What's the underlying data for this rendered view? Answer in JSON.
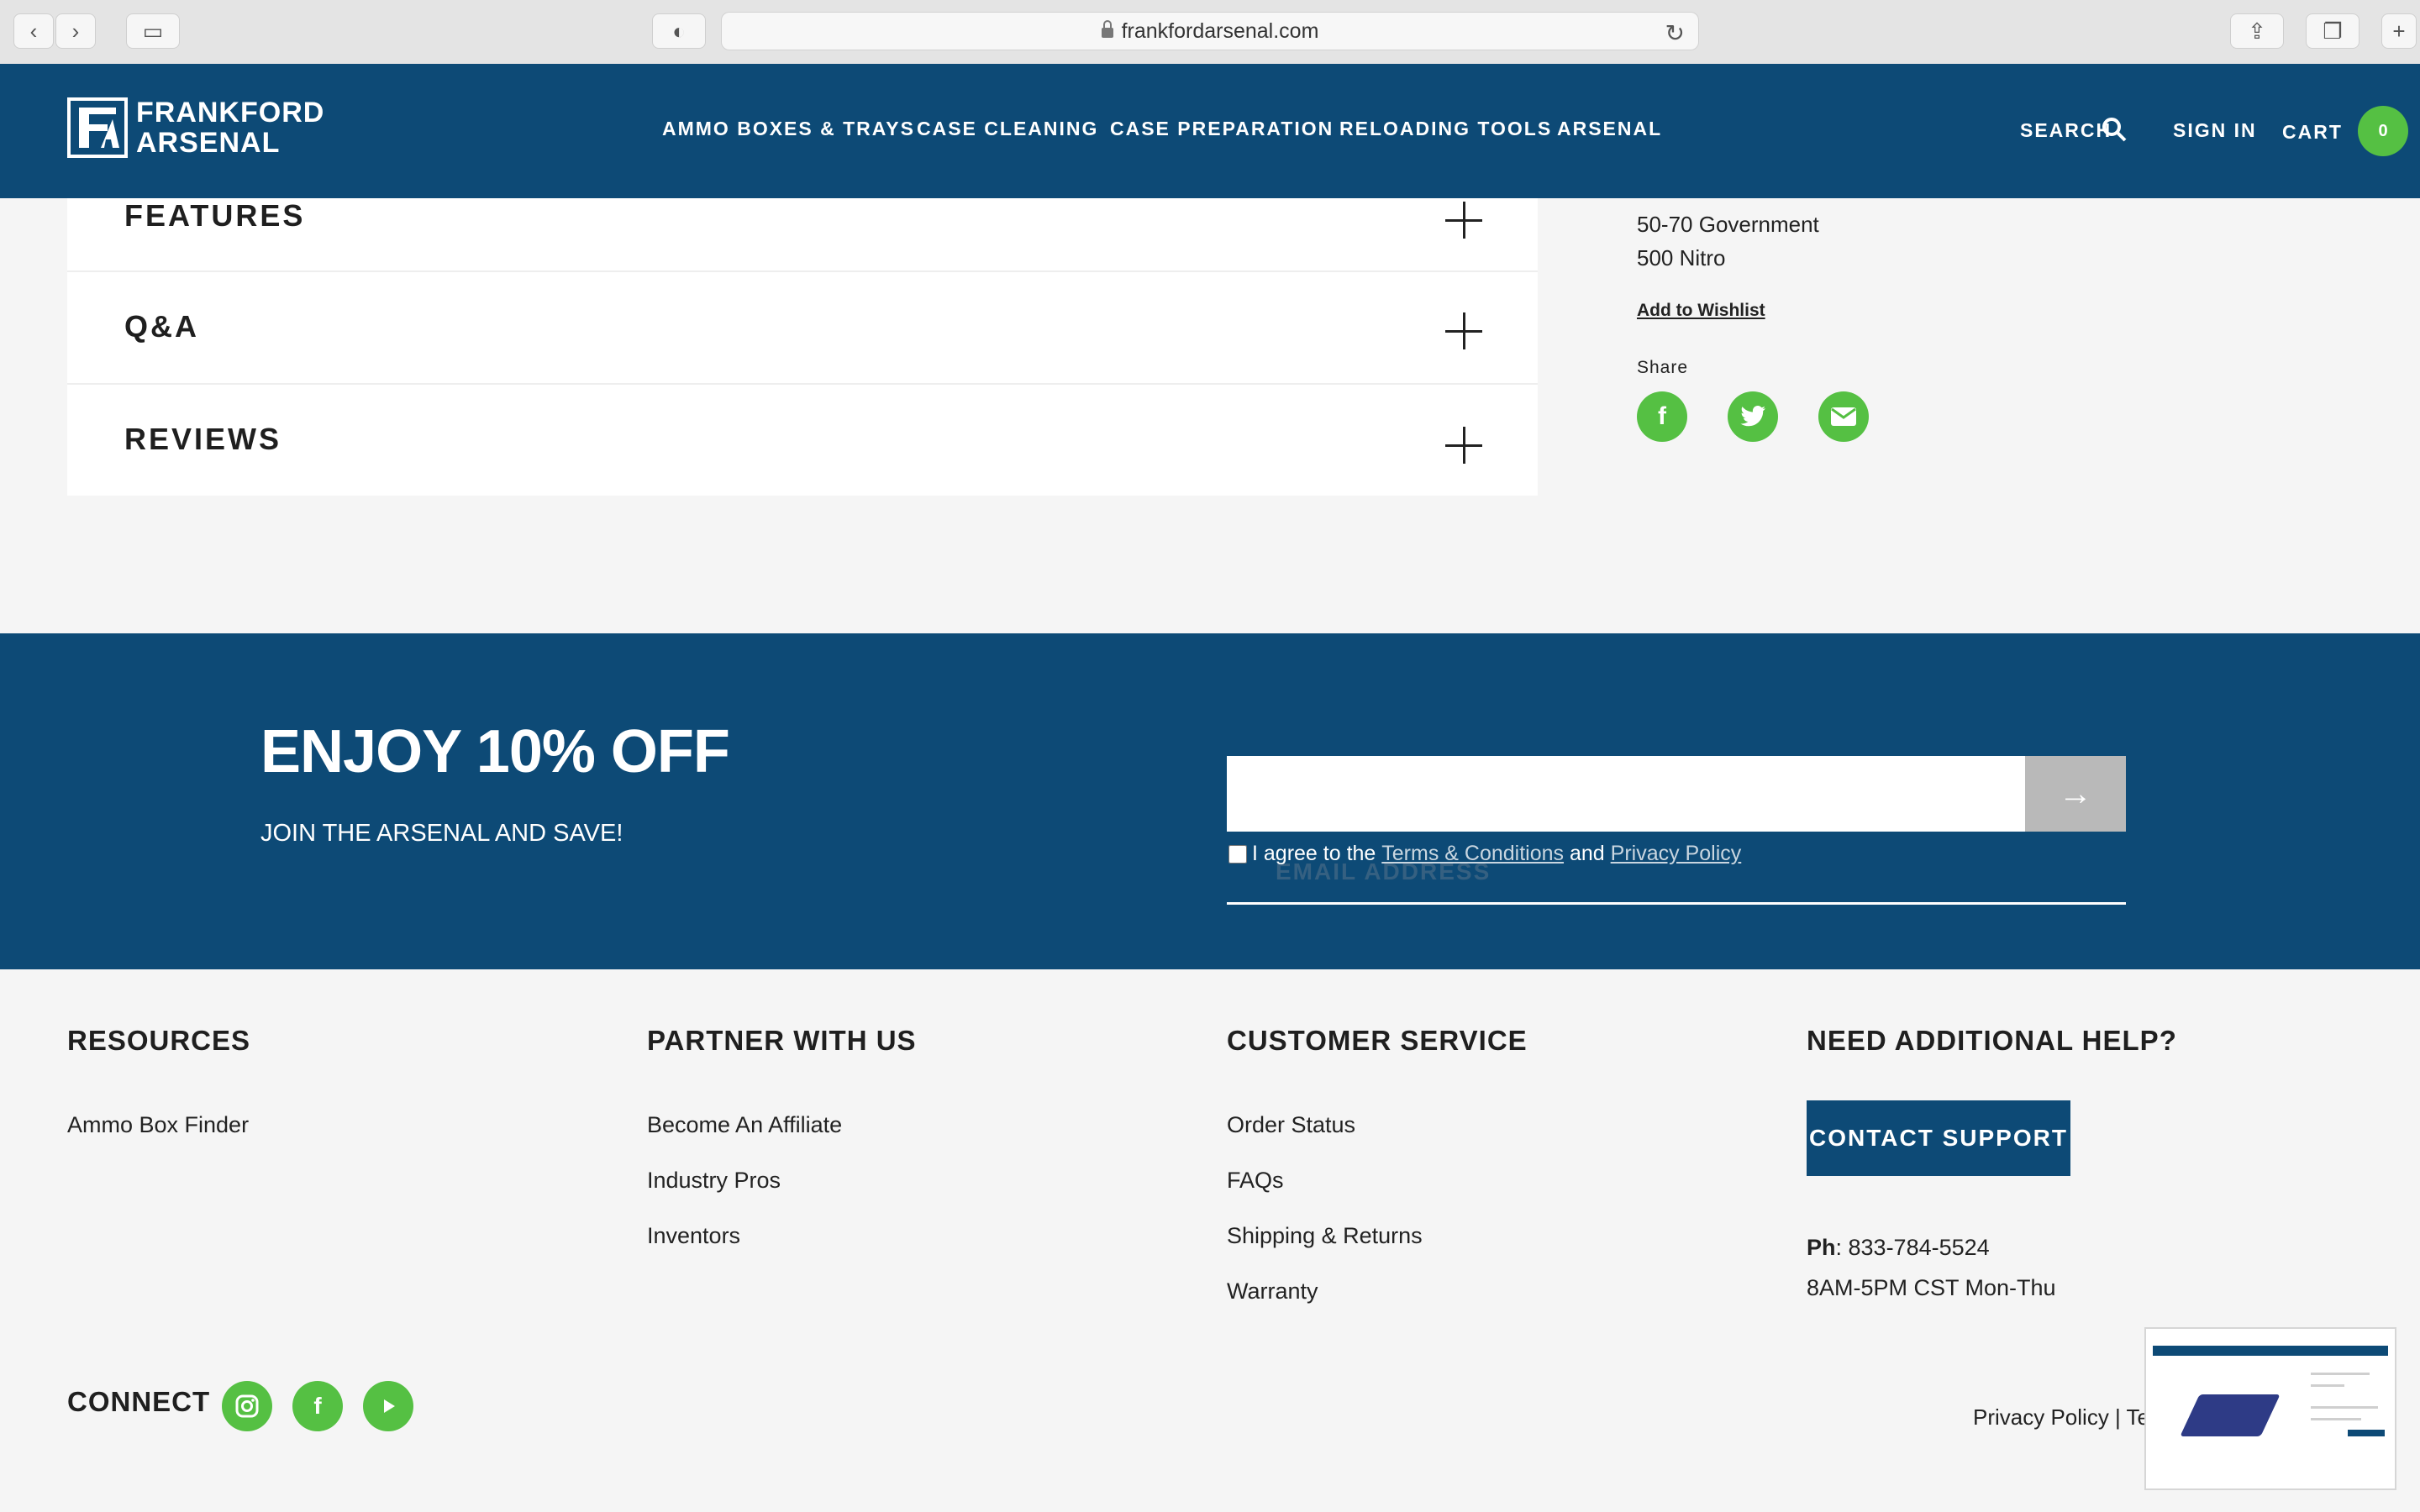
{
  "browser": {
    "url": "frankfordarsenal.com"
  },
  "header": {
    "logo_line1": "FRANKFORD",
    "logo_line2": "ARSENAL",
    "nav": [
      "AMMO BOXES & TRAYS",
      "CASE CLEANING",
      "CASE PREPARATION",
      "RELOADING TOOLS",
      "ARSENAL"
    ],
    "search_label": "SEARCH",
    "signin_label": "SIGN IN",
    "cart_label": "CART",
    "cart_count": "0"
  },
  "accordion": {
    "items": [
      "FEATURES",
      "Q&A",
      "REVIEWS"
    ]
  },
  "product_side": {
    "calibers": [
      "50-70 Government",
      "500 Nitro"
    ],
    "wishlist_label": "Add to Wishlist",
    "share_label": "Share",
    "share_icons": [
      "facebook-icon",
      "twitter-icon",
      "email-icon"
    ]
  },
  "newsletter": {
    "title": "ENJOY 10% OFF",
    "subtitle": "JOIN THE ARSENAL AND SAVE!",
    "email_label": "EMAIL ADDRESS",
    "agree_prefix": "I agree to the",
    "terms_link": "Terms & Conditions",
    "and_text": "and",
    "privacy_link": "Privacy Policy",
    "submit_icon": "arrow-right-icon"
  },
  "footer": {
    "resources": {
      "heading": "RESOURCES",
      "links": [
        "Ammo Box Finder"
      ]
    },
    "partner": {
      "heading": "PARTNER WITH US",
      "links": [
        "Become An Affiliate",
        "Industry Pros",
        "Inventors"
      ]
    },
    "customer_service": {
      "heading": "CUSTOMER SERVICE",
      "links": [
        "Order Status",
        "FAQs",
        "Shipping & Returns",
        "Warranty"
      ]
    },
    "help": {
      "heading": "NEED ADDITIONAL HELP?",
      "button": "CONTACT SUPPORT",
      "phone_label": "Ph",
      "phone": ": 833-784-5524",
      "hours": "8AM-5PM CST Mon-Thu"
    },
    "connect_label": "CONNECT",
    "social_icons": [
      "instagram-icon",
      "facebook-icon",
      "youtube-icon"
    ],
    "bottom_links": "Privacy Policy | Te"
  },
  "colors": {
    "brand_blue": "#0d4a76",
    "accent_green": "#55c043"
  }
}
